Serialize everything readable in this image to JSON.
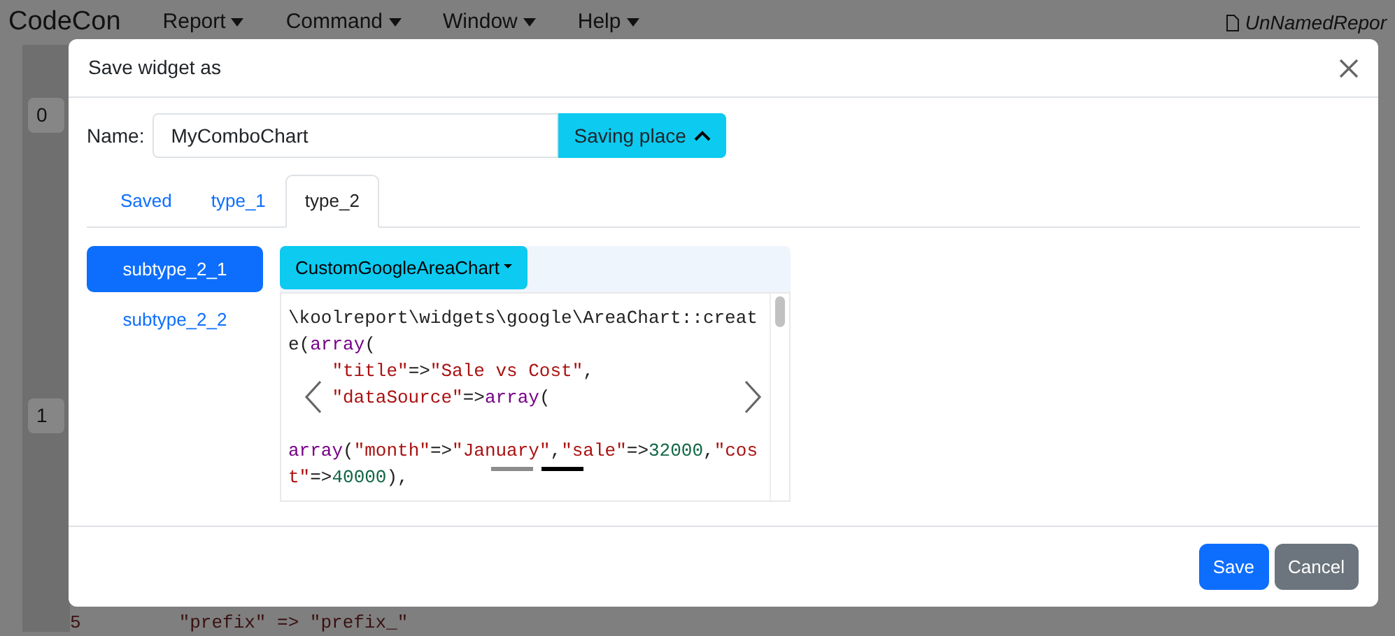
{
  "app": {
    "brand": "CodeCon",
    "menus": [
      {
        "label": "Report"
      },
      {
        "label": "Command"
      },
      {
        "label": "Window"
      },
      {
        "label": "Help"
      }
    ],
    "report_name": "UnNamedRepor",
    "panel_tabs": [
      "0",
      "1"
    ],
    "line_number": "5",
    "code_line": "\"prefix\" => \"prefix_\""
  },
  "dialog": {
    "title": "Save widget as",
    "name_label": "Name:",
    "name_value": "MyComboChart",
    "place_button": "Saving place",
    "tabs": [
      {
        "label": "Saved",
        "selected": false
      },
      {
        "label": "type_1",
        "selected": false
      },
      {
        "label": "type_2",
        "selected": true
      }
    ],
    "subtypes": [
      {
        "label": "subtype_2_1",
        "selected": true
      },
      {
        "label": "subtype_2_2",
        "selected": false
      }
    ],
    "widget_dropdown": "CustomGoogleAreaChart",
    "code_lines": [
      {
        "tokens": [
          {
            "kind": "plain",
            "text": "\\koolreport\\widgets\\google\\AreaChart::creat"
          }
        ]
      },
      {
        "tokens": [
          {
            "kind": "plain",
            "text": "e("
          },
          {
            "kind": "keyword",
            "text": "array"
          },
          {
            "kind": "plain",
            "text": "("
          }
        ]
      },
      {
        "indent": true,
        "tokens": [
          {
            "kind": "string",
            "text": "\"title\""
          },
          {
            "kind": "plain",
            "text": "=>"
          },
          {
            "kind": "string",
            "text": "\"Sale vs Cost\""
          },
          {
            "kind": "plain",
            "text": ","
          }
        ]
      },
      {
        "indent": true,
        "tokens": [
          {
            "kind": "string",
            "text": "\"dataSource\""
          },
          {
            "kind": "plain",
            "text": "=>"
          },
          {
            "kind": "keyword",
            "text": "array"
          },
          {
            "kind": "plain",
            "text": "("
          }
        ]
      },
      {
        "blank_before": true,
        "tokens": [
          {
            "kind": "keyword",
            "text": "array"
          },
          {
            "kind": "plain",
            "text": "("
          },
          {
            "kind": "string",
            "text": "\"month\""
          },
          {
            "kind": "plain",
            "text": "=>"
          },
          {
            "kind": "string",
            "text": "\"January\""
          },
          {
            "kind": "plain",
            "text": ","
          },
          {
            "kind": "string",
            "text": "\"sale\""
          },
          {
            "kind": "plain",
            "text": "=>"
          },
          {
            "kind": "number",
            "text": "32000"
          },
          {
            "kind": "plain",
            "text": ","
          },
          {
            "kind": "string",
            "text": "\"cos"
          }
        ]
      },
      {
        "tokens": [
          {
            "kind": "string",
            "text": "t\""
          },
          {
            "kind": "plain",
            "text": "=>"
          },
          {
            "kind": "number",
            "text": "40000"
          },
          {
            "kind": "plain",
            "text": "),"
          }
        ]
      }
    ],
    "slides": [
      {
        "selected": false
      },
      {
        "selected": true
      }
    ],
    "buttons": [
      {
        "label": "Save",
        "kind": "primary"
      },
      {
        "label": "Cancel",
        "kind": "secondary"
      }
    ]
  }
}
